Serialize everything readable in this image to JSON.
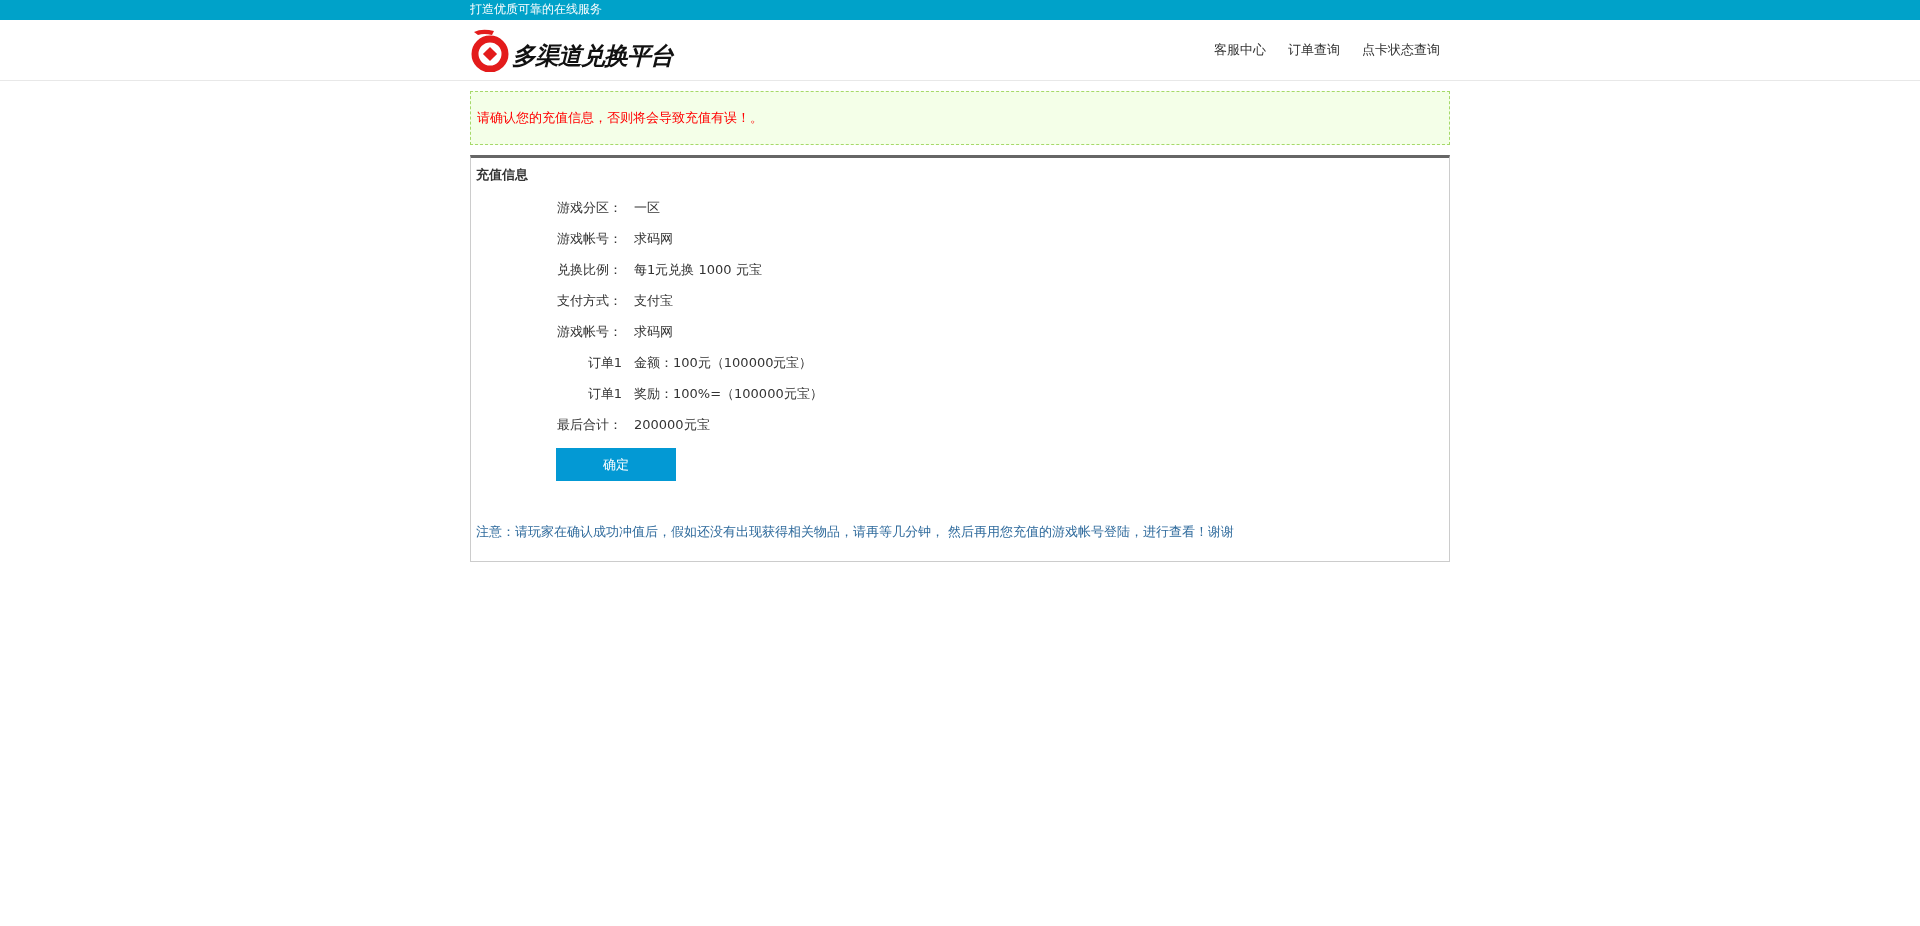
{
  "top_bar": {
    "slogan": "打造优质可靠的在线服务"
  },
  "header": {
    "logo_text": "多渠道兑换平台",
    "nav": [
      "客服中心",
      "订单查询",
      "点卡状态查询"
    ]
  },
  "alert": "请确认您的充值信息，否则将会导致充值有误！。",
  "panel": {
    "title": "充值信息",
    "rows": [
      {
        "label": "游戏分区：",
        "value": "一区"
      },
      {
        "label": "游戏帐号：",
        "value": "求码网"
      },
      {
        "label": "兑换比例：",
        "value": "每1元兑换 1000 元宝"
      },
      {
        "label": "支付方式：",
        "value": "支付宝"
      },
      {
        "label": "游戏帐号：",
        "value": "求码网"
      },
      {
        "label": "订单1",
        "value": "金额：100元（100000元宝）"
      },
      {
        "label": "订单1",
        "value": "奖励：100%=（100000元宝）"
      },
      {
        "label": "最后合计：",
        "value": "200000元宝"
      }
    ],
    "button": "确定",
    "note": "注意：请玩家在确认成功冲值后，假如还没有出现获得相关物品，请再等几分钟， 然后再用您充值的游戏帐号登陆，进行查看！谢谢"
  }
}
